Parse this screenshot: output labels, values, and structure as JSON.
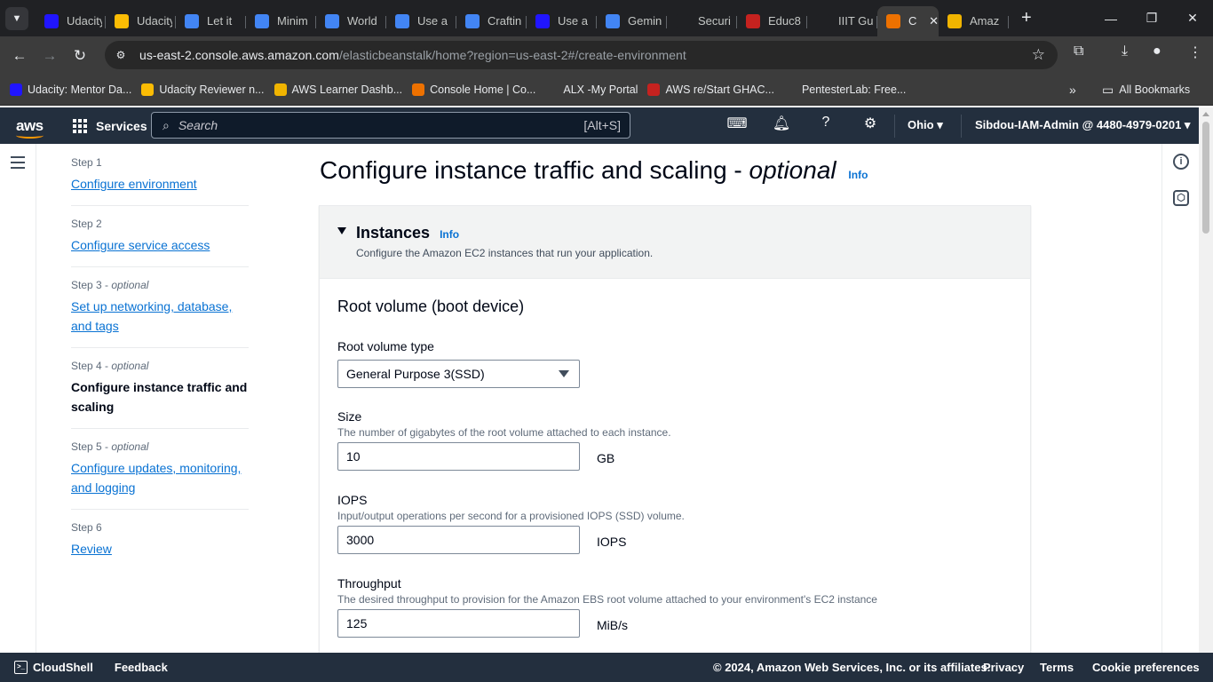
{
  "browser": {
    "tabs": [
      {
        "title": "Udacity",
        "icon": "udacity-icon",
        "color": "#2015ff"
      },
      {
        "title": "Udacity",
        "icon": "google-drive-icon",
        "color": "#fbbc04"
      },
      {
        "title": "Let it",
        "icon": "google-docs-icon",
        "color": "#4285f4"
      },
      {
        "title": "Minim",
        "icon": "google-docs-icon",
        "color": "#4285f4"
      },
      {
        "title": "World",
        "icon": "google-docs-icon",
        "color": "#4285f4"
      },
      {
        "title": "Use a",
        "icon": "google-docs-icon",
        "color": "#4285f4"
      },
      {
        "title": "Craftin",
        "icon": "google-slides-icon",
        "color": "#4285f4"
      },
      {
        "title": "Use a",
        "icon": "udacity-icon",
        "color": "#2015ff"
      },
      {
        "title": "Gemin",
        "icon": "gemini-icon",
        "color": "#4285f4"
      },
      {
        "title": "Securi",
        "icon": "openai-icon",
        "color": "#202124"
      },
      {
        "title": "Educ8",
        "icon": "educ8-icon",
        "color": "#c5221f"
      },
      {
        "title": "IIIT Gu",
        "icon": "openai-icon",
        "color": "#202124"
      },
      {
        "title": "C",
        "icon": "aws-console-icon",
        "color": "#ed7100",
        "active": true
      },
      {
        "title": "Amaz",
        "icon": "aws-box-icon",
        "color": "#f0b400"
      }
    ],
    "url_host": "us-east-2.console.aws.amazon.com",
    "url_path": "/elasticbeanstalk/home?region=us-east-2#/create-environment",
    "bookmarks": [
      {
        "label": "Udacity: Mentor Da...",
        "icon": "udacity-icon",
        "color": "#2015ff"
      },
      {
        "label": "Udacity Reviewer n...",
        "icon": "google-drive-icon",
        "color": "#fbbc04"
      },
      {
        "label": "AWS Learner Dashb...",
        "icon": "aws-box-icon",
        "color": "#f0b400"
      },
      {
        "label": "Console Home | Co...",
        "icon": "aws-console-icon",
        "color": "#ed7100"
      },
      {
        "label": "ALX -My Portal",
        "icon": "alx-icon",
        "color": "#3c3c3c"
      },
      {
        "label": "AWS re/Start GHAC...",
        "icon": "aws-icon",
        "color": "#c5221f"
      },
      {
        "label": "PentesterLab: Free...",
        "icon": "pentesterlab-icon",
        "color": "#3c3c3c"
      }
    ],
    "all_bookmarks": "All Bookmarks"
  },
  "aws_header": {
    "logo": "aws",
    "services": "Services",
    "search_placeholder": "Search",
    "search_shortcut": "[Alt+S]",
    "region": "Ohio",
    "account": "Sibdou-IAM-Admin @ 4480-4979-0201"
  },
  "steps": [
    {
      "step": "Step 1",
      "optional": "",
      "label": "Configure environment",
      "current": false
    },
    {
      "step": "Step 2",
      "optional": "",
      "label": "Configure service access",
      "current": false
    },
    {
      "step": "Step 3",
      "optional": "optional",
      "label": "Set up networking, database, and tags",
      "current": false
    },
    {
      "step": "Step 4",
      "optional": "optional",
      "label": "Configure instance traffic and scaling",
      "current": true
    },
    {
      "step": "Step 5",
      "optional": "optional",
      "label": "Configure updates, monitoring, and logging",
      "current": false
    },
    {
      "step": "Step 6",
      "optional": "",
      "label": "Review",
      "current": false
    }
  ],
  "page": {
    "title_main": "Configure instance traffic and scaling -",
    "title_optional": "optional",
    "info": "Info"
  },
  "instances_panel": {
    "title": "Instances",
    "info": "Info",
    "description": "Configure the Amazon EC2 instances that run your application.",
    "section_title": "Root volume (boot device)",
    "root_volume_type": {
      "label": "Root volume type",
      "value": "General Purpose 3(SSD)"
    },
    "size": {
      "label": "Size",
      "description": "The number of gigabytes of the root volume attached to each instance.",
      "value": "10",
      "unit": "GB"
    },
    "iops": {
      "label": "IOPS",
      "description": "Input/output operations per second for a provisioned IOPS (SSD) volume.",
      "value": "3000",
      "unit": "IOPS"
    },
    "throughput": {
      "label": "Throughput",
      "description": "The desired throughput to provision for the Amazon EBS root volume attached to your environment's EC2 instance",
      "value": "125",
      "unit": "MiB/s"
    }
  },
  "footer": {
    "cloudshell": "CloudShell",
    "feedback": "Feedback",
    "copyright": "© 2024, Amazon Web Services, Inc. or its affiliates.",
    "privacy": "Privacy",
    "terms": "Terms",
    "cookies": "Cookie preferences"
  },
  "colors": {
    "aws_header": "#232f3e",
    "link": "#0972d3",
    "aws_orange": "#ff9900"
  }
}
